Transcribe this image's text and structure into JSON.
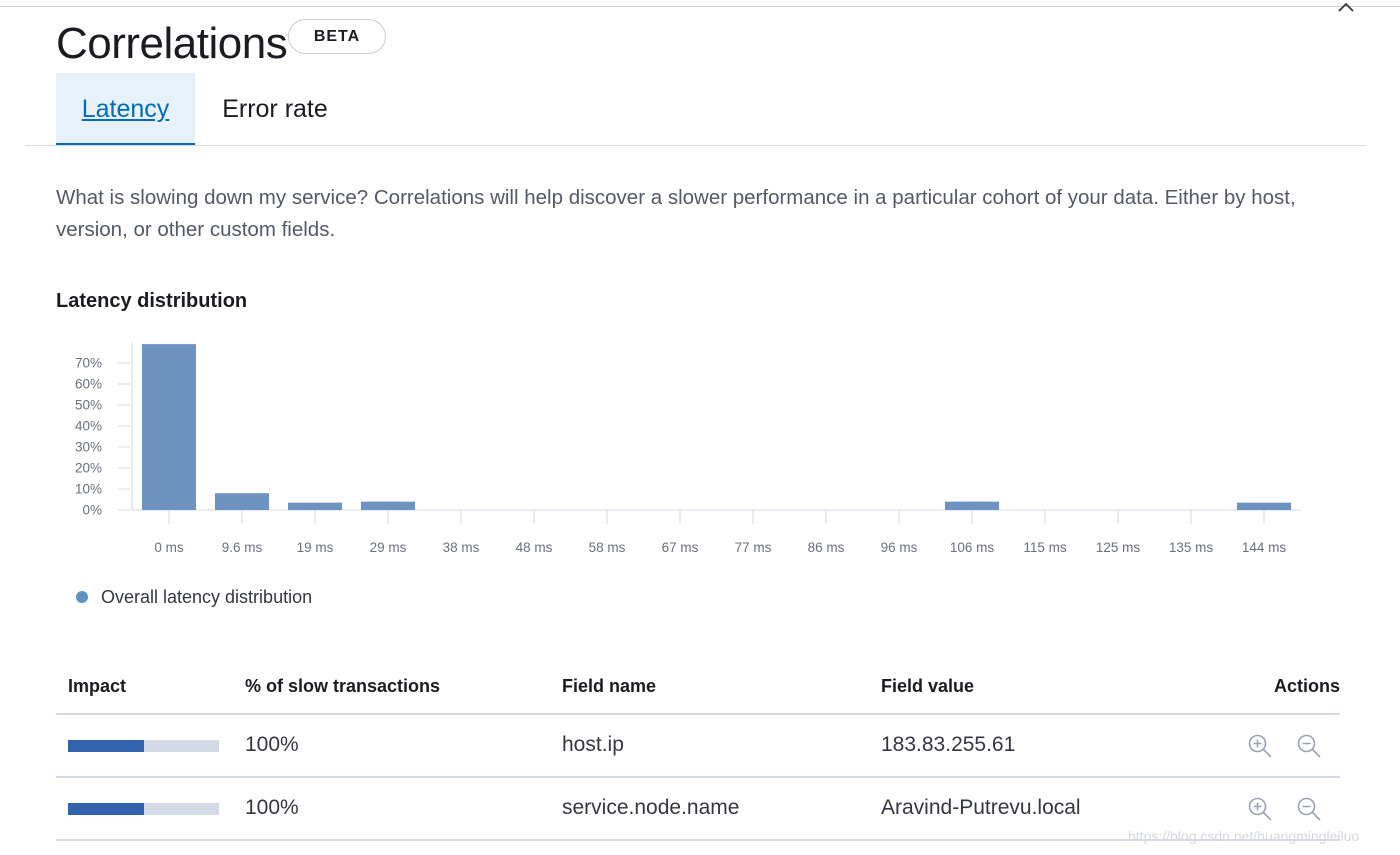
{
  "header": {
    "title": "Correlations",
    "badge": "BETA",
    "close_icon": "close-icon"
  },
  "tabs": [
    {
      "label": "Latency",
      "selected": true
    },
    {
      "label": "Error rate",
      "selected": false
    }
  ],
  "description": "What is slowing down my service? Correlations will help discover a slower performance in a particular cohort of your data. Either by host, version, or other custom fields.",
  "distribution": {
    "title": "Latency distribution"
  },
  "chart_data": {
    "type": "bar",
    "title": "",
    "xlabel": "",
    "ylabel": "",
    "ylim": [
      0,
      80
    ],
    "y_ticks": [
      "0%",
      "10%",
      "20%",
      "30%",
      "40%",
      "50%",
      "60%",
      "70%"
    ],
    "y_tick_values": [
      0,
      10,
      20,
      30,
      40,
      50,
      60,
      70
    ],
    "categories": [
      "0 ms",
      "9.6 ms",
      "19 ms",
      "29 ms",
      "38 ms",
      "48 ms",
      "58 ms",
      "67 ms",
      "77 ms",
      "86 ms",
      "96 ms",
      "106 ms",
      "115 ms",
      "125 ms",
      "135 ms",
      "144 ms"
    ],
    "series": [
      {
        "name": "Overall latency distribution",
        "color": "#6f93c0",
        "values": [
          79,
          8,
          3.5,
          4,
          0,
          0,
          0,
          0,
          0,
          0,
          0,
          4,
          0,
          0,
          0,
          3.5
        ]
      }
    ],
    "grid": false,
    "legend_position": "bottom-left"
  },
  "legend": {
    "label": "Overall latency distribution",
    "color": "#6092c0"
  },
  "table": {
    "headers": {
      "impact": "Impact",
      "pct": "% of slow transactions",
      "field_name": "Field name",
      "field_value": "Field value",
      "actions": "Actions"
    },
    "rows": [
      {
        "impact": 0.5,
        "pct": "100%",
        "field_name": "host.ip",
        "field_value": "183.83.255.61"
      },
      {
        "impact": 0.5,
        "pct": "100%",
        "field_name": "service.node.name",
        "field_value": "Aravind-Putrevu.local"
      }
    ],
    "action_icons": [
      "zoom-in-icon",
      "zoom-out-icon"
    ]
  },
  "watermark": "https://blog.csdn.net/huangmingleiluo"
}
